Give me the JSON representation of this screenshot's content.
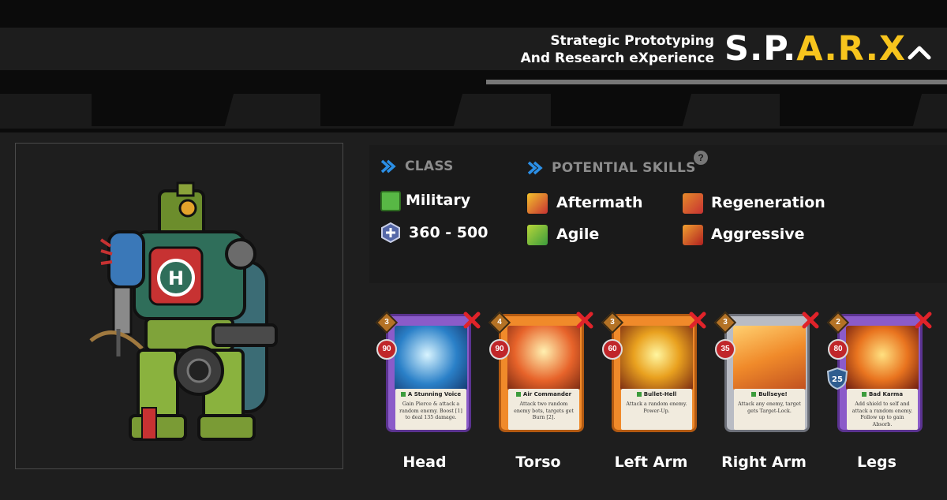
{
  "header": {
    "tagline_line1": "Strategic Prototyping",
    "tagline_line2": "And Research eXperience",
    "logo_white": "S.P.",
    "logo_yellow": "A.R.X",
    "accent_color": "#f7c41d"
  },
  "icons": {
    "collapse": "chevron-up-icon",
    "section_arrow": "chevron-right-icon",
    "help": "help-icon",
    "remove": "close-icon"
  },
  "class_section": {
    "heading": "CLASS",
    "class_name": "Military",
    "hp_range": "360 - 500"
  },
  "skills_section": {
    "heading": "POTENTIAL SKILLS",
    "help_glyph": "?",
    "skills": [
      {
        "name": "Aftermath"
      },
      {
        "name": "Regeneration"
      },
      {
        "name": "Agile"
      },
      {
        "name": "Aggressive"
      }
    ]
  },
  "parts": [
    {
      "slot": "Head",
      "cost": "3",
      "damage": "90",
      "card_name": "A Stunning Voice",
      "desc": "Gain Pierce & attack a random enemy. Boost [1] to deal 135 damage.",
      "frame": "purple"
    },
    {
      "slot": "Torso",
      "cost": "4",
      "damage": "90",
      "card_name": "Air Commander",
      "desc": "Attack two random enemy bots, targets get Burn [2].",
      "frame": "orange"
    },
    {
      "slot": "Left Arm",
      "cost": "3",
      "damage": "60",
      "card_name": "Bullet-Hell",
      "desc": "Attack a random enemy. Power-Up.",
      "frame": "orange"
    },
    {
      "slot": "Right Arm",
      "cost": "3",
      "damage": "35",
      "card_name": "Bullseye!",
      "desc": "Attack any enemy, target gets Target-Lock.",
      "frame": "grey"
    },
    {
      "slot": "Legs",
      "cost": "2",
      "damage": "80",
      "shield": "25",
      "card_name": "Bad Karma",
      "desc": "Add shield to self and attack a random enemy. Follow up to gain Absorb.",
      "frame": "purple"
    }
  ]
}
